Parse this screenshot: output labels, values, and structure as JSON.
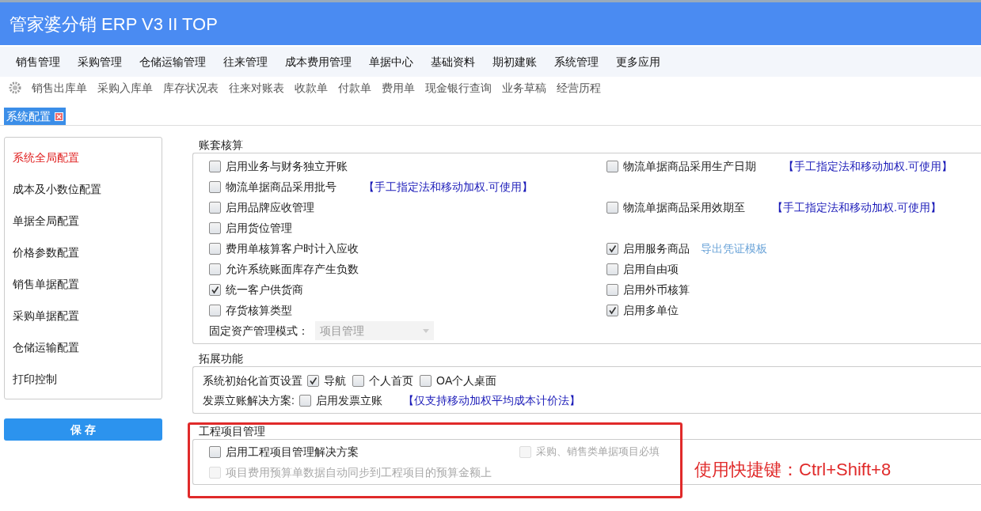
{
  "header": {
    "title": "管家婆分销 ERP V3 II TOP"
  },
  "menu": [
    "销售管理",
    "采购管理",
    "仓储运输管理",
    "往来管理",
    "成本费用管理",
    "单据中心",
    "基础资料",
    "期初建账",
    "系统管理",
    "更多应用"
  ],
  "toolbar": [
    "销售出库单",
    "采购入库单",
    "库存状况表",
    "往来对账表",
    "收款单",
    "付款单",
    "费用单",
    "现金银行查询",
    "业务草稿",
    "经营历程"
  ],
  "tabs": [
    {
      "label": "系统配置",
      "selected": true
    }
  ],
  "sidebar": {
    "items": [
      {
        "label": "系统全局配置",
        "selected": true
      },
      {
        "label": "成本及小数位配置",
        "selected": false
      },
      {
        "label": "单据全局配置",
        "selected": false
      },
      {
        "label": "价格参数配置",
        "selected": false
      },
      {
        "label": "销售单据配置",
        "selected": false
      },
      {
        "label": "采购单据配置",
        "selected": false
      },
      {
        "label": "仓储运输配置",
        "selected": false
      },
      {
        "label": "打印控制",
        "selected": false
      }
    ],
    "save_button": "保 存"
  },
  "accounting": {
    "title": "账套核算",
    "rows": [
      {
        "left": {
          "label": "启用业务与财务独立开账",
          "checked": false
        },
        "right": {
          "label": "物流单据商品采用生产日期",
          "checked": false,
          "note": "【手工指定法和移动加权.可使用】"
        }
      },
      {
        "left": {
          "label": "物流单据商品采用批号",
          "checked": false,
          "note": "【手工指定法和移动加权.可使用】"
        }
      },
      {
        "left": {
          "label": "启用品牌应收管理",
          "checked": false
        },
        "right": {
          "label": "物流单据商品采用效期至",
          "checked": false,
          "note": "【手工指定法和移动加权.可使用】"
        }
      },
      {
        "left": {
          "label": "启用货位管理",
          "checked": false
        }
      },
      {
        "left": {
          "label": "费用单核算客户时计入应收",
          "checked": false
        },
        "right": {
          "label": "启用服务商品",
          "checked": true,
          "link": "导出凭证模板"
        }
      },
      {
        "left": {
          "label": "允许系统账面库存产生负数",
          "checked": false
        },
        "right": {
          "label": "启用自由项",
          "checked": false
        }
      },
      {
        "left": {
          "label": "统一客户供货商",
          "checked": true
        },
        "right": {
          "label": "启用外币核算",
          "checked": false
        }
      },
      {
        "left": {
          "label": "存货核算类型",
          "checked": false
        },
        "right": {
          "label": "启用多单位",
          "checked": true
        }
      }
    ],
    "asset_mode": {
      "label": "固定资产管理模式：",
      "value": "项目管理"
    }
  },
  "extension": {
    "title": "拓展功能",
    "home_setting": {
      "label": "系统初始化首页设置",
      "options": [
        {
          "label": "导航",
          "checked": true
        },
        {
          "label": "个人首页",
          "checked": false
        },
        {
          "label": "OA个人桌面",
          "checked": false
        }
      ]
    },
    "invoice": {
      "label": "发票立账解决方案:",
      "option": {
        "label": "启用发票立账",
        "checked": false
      },
      "note": "【仅支持移动加权平均成本计价法】"
    }
  },
  "project": {
    "title": "工程项目管理",
    "items": [
      {
        "label": "启用工程项目管理解决方案",
        "checked": false,
        "disabled": false
      },
      {
        "label": "采购、销售类单据项目必填",
        "checked": false,
        "disabled": true
      },
      {
        "label": "项目费用预算单数据自动同步到工程项目的预算金额上",
        "checked": false,
        "disabled": true
      }
    ]
  },
  "annotation": {
    "text": "使用快捷键：Ctrl+Shift+8"
  }
}
